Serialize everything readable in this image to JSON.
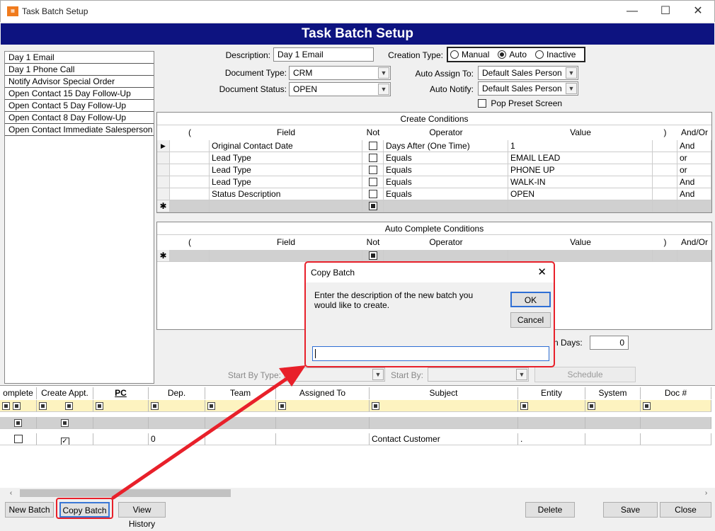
{
  "window": {
    "title": "Task Batch Setup",
    "app_icon": "tasks-app-icon"
  },
  "header": {
    "title": "Task Batch Setup"
  },
  "batch_list": [
    "Day 1 Email",
    "Day 1 Phone Call",
    "Notify Advisor Special Order",
    "Open Contact 15 Day Follow-Up",
    "Open Contact 5 Day Follow-Up",
    "Open Contact 8 Day Follow-Up",
    "Open Contact Immediate Salesperson"
  ],
  "form": {
    "description_label": "Description:",
    "description_value": "Day 1 Email",
    "document_type_label": "Document Type:",
    "document_type_value": "CRM",
    "document_status_label": "Document Status:",
    "document_status_value": "OPEN",
    "creation_type_label": "Creation Type:",
    "creation_options": [
      "Manual",
      "Auto",
      "Inactive"
    ],
    "creation_selected": "Auto",
    "auto_assign_label": "Auto Assign To:",
    "auto_assign_value": "Default Sales Person",
    "auto_notify_label": "Auto Notify:",
    "auto_notify_value": "Default Sales Person",
    "pop_preset_label": "Pop Preset Screen"
  },
  "create_conditions": {
    "title": "Create Conditions",
    "columns": [
      "(",
      "Field",
      "Not",
      "Operator",
      "Value",
      ")",
      "And/Or"
    ],
    "rows": [
      {
        "field": "Original Contact Date",
        "operator": "Days After (One Time)",
        "value": "1",
        "andor": "And"
      },
      {
        "field": "Lead Type",
        "operator": "Equals",
        "value": "EMAIL LEAD",
        "andor": "or"
      },
      {
        "field": "Lead Type",
        "operator": "Equals",
        "value": "PHONE UP",
        "andor": "or"
      },
      {
        "field": "Lead Type",
        "operator": "Equals",
        "value": "WALK-IN",
        "andor": "And"
      },
      {
        "field": "Status Description",
        "operator": "Equals",
        "value": "OPEN",
        "andor": "And"
      }
    ],
    "row_marker": "▶",
    "new_marker": "✱"
  },
  "auto_complete": {
    "title": "Auto Complete Conditions",
    "columns": [
      "(",
      "Field",
      "Not",
      "Operator",
      "Value",
      ")",
      "And/Or"
    ],
    "new_marker": "✱"
  },
  "days": {
    "label": "n Days:",
    "value": "0"
  },
  "schedule": {
    "start_by_type_label": "Start By Type:",
    "start_by_label": "Start By:",
    "schedule_button": "Schedule"
  },
  "tasks_grid": {
    "columns": [
      "omplete",
      "Create Appt.",
      "PC",
      "Dep.",
      "Team",
      "Assigned To",
      "Subject",
      "Entity",
      "System",
      "Doc #"
    ],
    "row": {
      "dep": "0",
      "subject": "Contact Customer",
      "entity": "."
    }
  },
  "buttons": {
    "new_batch": "New Batch",
    "copy_batch": "Copy Batch",
    "view_history": "View History",
    "delete": "Delete",
    "save": "Save",
    "close": "Close"
  },
  "dialog": {
    "title": "Copy Batch",
    "message": "Enter the description of the new batch you would like to create.",
    "ok": "OK",
    "cancel": "Cancel",
    "input_value": ""
  },
  "colors": {
    "header_bg": "#0d1380",
    "highlight_red": "#e8202a",
    "filter_row": "#fdf3c0"
  }
}
